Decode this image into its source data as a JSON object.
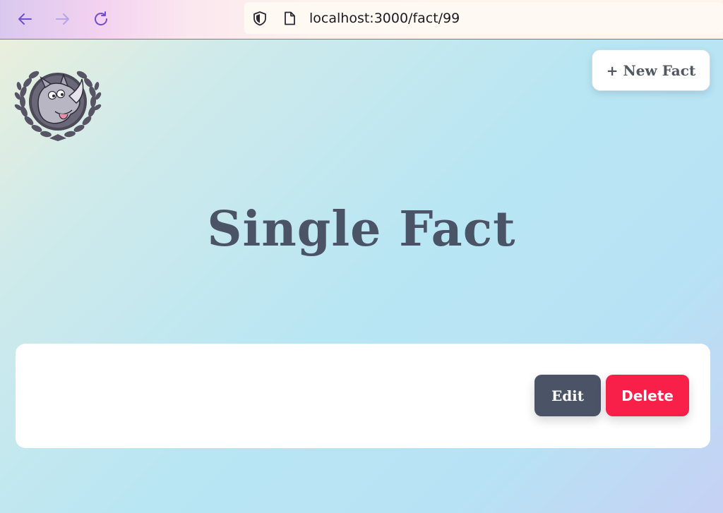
{
  "browser": {
    "url": "localhost:3000/fact/99",
    "icons": [
      "back-arrow-icon",
      "forward-arrow-icon",
      "reload-icon",
      "shield-icon",
      "page-icon"
    ]
  },
  "header": {
    "logo": "rhino-laurel-logo",
    "new_fact_label": "+ New Fact"
  },
  "main": {
    "title": "Single Fact",
    "fact": {
      "text": "",
      "edit_label": "Edit",
      "delete_label": "Delete"
    }
  },
  "colors": {
    "title": "#4b5467",
    "edit_bg": "#4b5467",
    "delete_bg": "#f81f49"
  }
}
